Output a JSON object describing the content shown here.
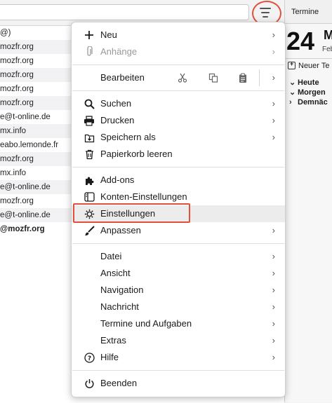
{
  "right_panel": {
    "tab_label": "Termine",
    "day": "24",
    "month": "M",
    "month_sub": "Feb",
    "new_event_label": "Neuer Te",
    "agenda": [
      {
        "label": "Heute",
        "expanded": true
      },
      {
        "label": "Morgen",
        "expanded": true
      },
      {
        "label": "Demnäc",
        "expanded": false
      }
    ]
  },
  "message_list": [
    {
      "text": "@)",
      "bold": false
    },
    {
      "text": "mozfr.org",
      "bold": false
    },
    {
      "text": "mozfr.org",
      "bold": false
    },
    {
      "text": "mozfr.org",
      "bold": false
    },
    {
      "text": "mozfr.org",
      "bold": false
    },
    {
      "text": "mozfr.org",
      "bold": false
    },
    {
      "text": "e@t-online.de",
      "bold": false
    },
    {
      "text": "mx.info",
      "bold": false
    },
    {
      "text": "eabo.lemonde.fr",
      "bold": false
    },
    {
      "text": "mozfr.org",
      "bold": false
    },
    {
      "text": "mx.info",
      "bold": false
    },
    {
      "text": "e@t-online.de",
      "bold": false
    },
    {
      "text": "mozfr.org",
      "bold": false
    },
    {
      "text": "e@t-online.de",
      "bold": false
    },
    {
      "text": "@mozfr.org",
      "bold": true
    }
  ],
  "menu": {
    "new": "Neu",
    "attachments": "Anhänge",
    "edit": "Bearbeiten",
    "search": "Suchen",
    "print": "Drucken",
    "save_as": "Speichern als",
    "empty_trash": "Papierkorb leeren",
    "addons": "Add-ons",
    "account_settings": "Konten-Einstellungen",
    "settings": "Einstellungen",
    "customize": "Anpassen",
    "file": "Datei",
    "view": "Ansicht",
    "navigation": "Navigation",
    "message": "Nachricht",
    "events_tasks": "Termine und Aufgaben",
    "extras": "Extras",
    "help": "Hilfe",
    "quit": "Beenden"
  },
  "icons": {
    "new": "plus-icon",
    "attachments": "paperclip-icon",
    "cut": "scissors-icon",
    "copy": "copy-icon",
    "paste": "clipboard-icon",
    "search": "magnifier-icon",
    "print": "printer-icon",
    "save": "save-icon",
    "trash": "trash-icon",
    "addons": "puzzle-icon",
    "account": "account-card-icon",
    "settings": "gear-icon",
    "customize": "brush-icon",
    "help": "help-icon",
    "quit": "power-icon"
  },
  "colors": {
    "highlight_outline": "#e0503c"
  }
}
